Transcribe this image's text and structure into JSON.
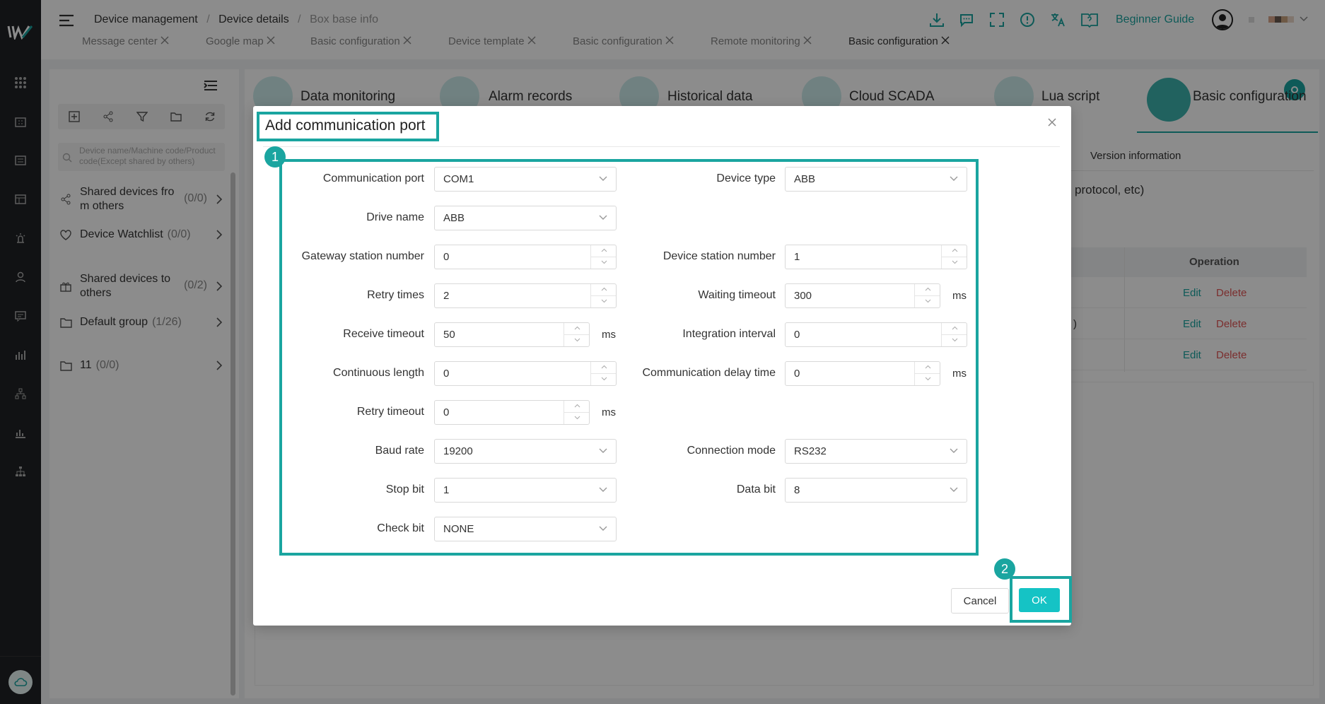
{
  "header": {
    "breadcrumb": [
      "Device management",
      "Device details",
      "Box base info"
    ],
    "beginner_guide": "Beginner Guide"
  },
  "tabs": [
    "Message center",
    "Google map",
    "Basic configuration",
    "Device template",
    "Basic configuration",
    "Remote monitoring",
    "Basic configuration"
  ],
  "sidebar": {
    "search_placeholder": "Device name/Machine code/Product code(Except shared by others)",
    "items": [
      {
        "label_line1": "Shared devices fro",
        "label_line2": "m others",
        "count": "(0/0)"
      },
      {
        "label": "Device Watchlist",
        "count": "(0/0)"
      },
      {
        "label_line1": "Shared devices to",
        "label_line2": "others",
        "count": "(0/2)"
      },
      {
        "label": "Default group",
        "count": "(1/26)"
      },
      {
        "label": "11",
        "count": "(0/0)"
      }
    ]
  },
  "background": {
    "feature_tabs": [
      "Data monitoring",
      "Alarm records",
      "Historical data",
      "Cloud SCADA",
      "Lua script",
      "Basic configuration"
    ],
    "version_info": "Version information",
    "protocol_text": "protocol, etc)",
    "paren_text": ")",
    "operation_header": "Operation",
    "edit": "Edit",
    "delete": "Delete"
  },
  "modal": {
    "title": "Add communication port",
    "cancel": "Cancel",
    "ok": "OK",
    "badge1": "1",
    "badge2": "2",
    "fields": {
      "communication_port": {
        "label": "Communication port",
        "value": "COM1"
      },
      "device_type": {
        "label": "Device type",
        "value": "ABB"
      },
      "drive_name": {
        "label": "Drive name",
        "value": "ABB"
      },
      "gateway_station_number": {
        "label": "Gateway station number",
        "value": "0"
      },
      "device_station_number": {
        "label": "Device station number",
        "value": "1"
      },
      "retry_times": {
        "label": "Retry times",
        "value": "2"
      },
      "waiting_timeout": {
        "label": "Waiting timeout",
        "value": "300",
        "unit": "ms"
      },
      "receive_timeout": {
        "label": "Receive timeout",
        "value": "50",
        "unit": "ms"
      },
      "integration_interval": {
        "label": "Integration interval",
        "value": "0"
      },
      "continuous_length": {
        "label": "Continuous length",
        "value": "0"
      },
      "communication_delay_time": {
        "label": "Communication delay time",
        "value": "0",
        "unit": "ms"
      },
      "retry_timeout": {
        "label": "Retry timeout",
        "value": "0",
        "unit": "ms"
      },
      "baud_rate": {
        "label": "Baud rate",
        "value": "19200"
      },
      "connection_mode": {
        "label": "Connection mode",
        "value": "RS232"
      },
      "stop_bit": {
        "label": "Stop bit",
        "value": "1"
      },
      "data_bit": {
        "label": "Data bit",
        "value": "8"
      },
      "check_bit": {
        "label": "Check bit",
        "value": "NONE"
      }
    }
  },
  "colors": {
    "accent": "#1aa5a0",
    "ok_button": "#15c3c5",
    "delete": "#e05555",
    "rail": "#1f2126"
  }
}
